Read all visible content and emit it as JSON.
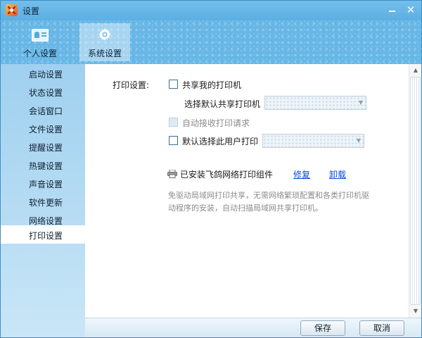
{
  "window": {
    "title": "设置"
  },
  "tabs": [
    {
      "label": "个人设置",
      "icon": "id-card-icon"
    },
    {
      "label": "系统设置",
      "icon": "gear-icon",
      "selected": true
    }
  ],
  "sidebar": {
    "items": [
      {
        "label": "启动设置"
      },
      {
        "label": "状态设置"
      },
      {
        "label": "会话窗口"
      },
      {
        "label": "文件设置"
      },
      {
        "label": "提醒设置"
      },
      {
        "label": "热键设置"
      },
      {
        "label": "声音设置"
      },
      {
        "label": "软件更新"
      },
      {
        "label": "网络设置"
      },
      {
        "label": "打印设置",
        "active": true
      }
    ]
  },
  "print": {
    "section_label": "打印设置:",
    "share_label": "共享我的打印机",
    "share_checked": false,
    "select_label": "选择默认共享打印机",
    "select_value": "",
    "auto_label": "自动接收打印请求",
    "auto_checked": false,
    "auto_disabled": true,
    "default_label": "默认选择此用户打印",
    "default_checked": false,
    "default_value": "",
    "installed_label": "已安装飞鸽网络打印组件",
    "repair_label": "修复",
    "uninstall_label": "卸载",
    "description": "免驱动局域网打印共享，无需网络繁琐配置和各类打印机驱动程序的安装，自动扫描局域网共享打印机。"
  },
  "footer": {
    "save_label": "保存",
    "cancel_label": "取消"
  },
  "colors": {
    "accent": "#5aaee0",
    "link": "#0b4fc8",
    "sidebar": "#b3dbf3"
  }
}
